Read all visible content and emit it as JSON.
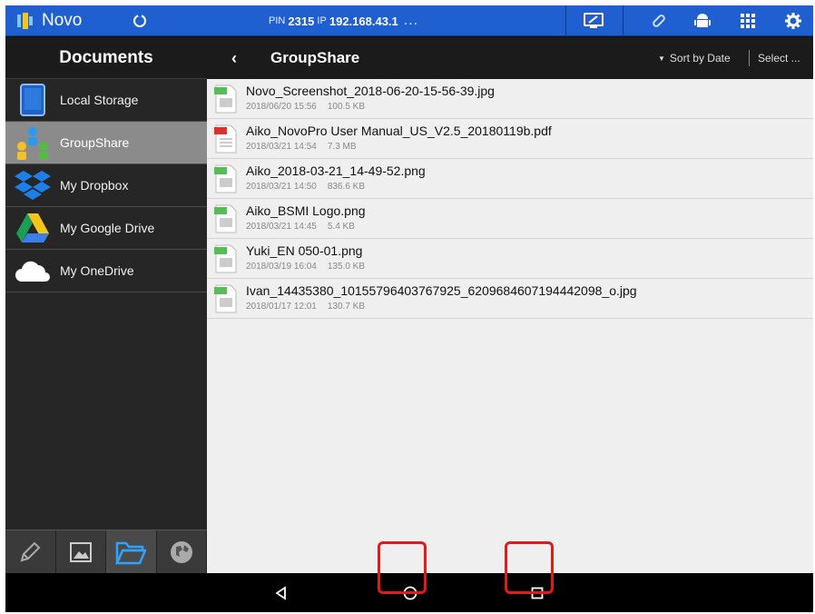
{
  "topbar": {
    "app_name": "Novo",
    "pin_label": "PIN",
    "pin": "2315",
    "ip_label": "IP",
    "ip": "192.168.43.1",
    "dots": "...",
    "colors": {
      "bar": "#1f5fcf"
    }
  },
  "sidebar": {
    "title": "Documents",
    "items": [
      {
        "label": "Local Storage",
        "icon": "tablet-icon",
        "active": false
      },
      {
        "label": "GroupShare",
        "icon": "group-users-icon",
        "active": true
      },
      {
        "label": "My Dropbox",
        "icon": "dropbox-icon",
        "active": false
      },
      {
        "label": "My Google Drive",
        "icon": "google-drive-icon",
        "active": false
      },
      {
        "label": "My OneDrive",
        "icon": "onedrive-cloud-icon",
        "active": false
      }
    ],
    "bottom_tabs": [
      "pen-icon",
      "image-icon",
      "folder-icon",
      "globe-icon"
    ],
    "active_bottom_tab": "folder-icon"
  },
  "content": {
    "folder_title": "GroupShare",
    "sort_label": "Sort by Date",
    "select_label": "Select ...",
    "files": [
      {
        "name": "Novo_Screenshot_2018-06-20-15-56-39.jpg",
        "date": "2018/06/20 15:56",
        "size": "100.5 KB",
        "type": "img"
      },
      {
        "name": "Aiko_NovoPro User Manual_US_V2.5_20180119b.pdf",
        "date": "2018/03/21 14:54",
        "size": "7.3 MB",
        "type": "pdf"
      },
      {
        "name": "Aiko_2018-03-21_14-49-52.png",
        "date": "2018/03/21 14:50",
        "size": "836.6 KB",
        "type": "img"
      },
      {
        "name": "Aiko_BSMI Logo.png",
        "date": "2018/03/21 14:45",
        "size": "5.4 KB",
        "type": "img"
      },
      {
        "name": "Yuki_EN 050-01.png",
        "date": "2018/03/19 16:04",
        "size": "135.0 KB",
        "type": "img"
      },
      {
        "name": "Ivan_14435380_10155796403767925_6209684607194442098_o.jpg",
        "date": "2018/01/17 12:01",
        "size": "130.7 KB",
        "type": "img"
      }
    ]
  },
  "navbar": {
    "buttons": [
      "back-triangle-icon",
      "home-circle-icon",
      "recents-square-icon"
    ],
    "highlight_color": "#e01b1b"
  }
}
